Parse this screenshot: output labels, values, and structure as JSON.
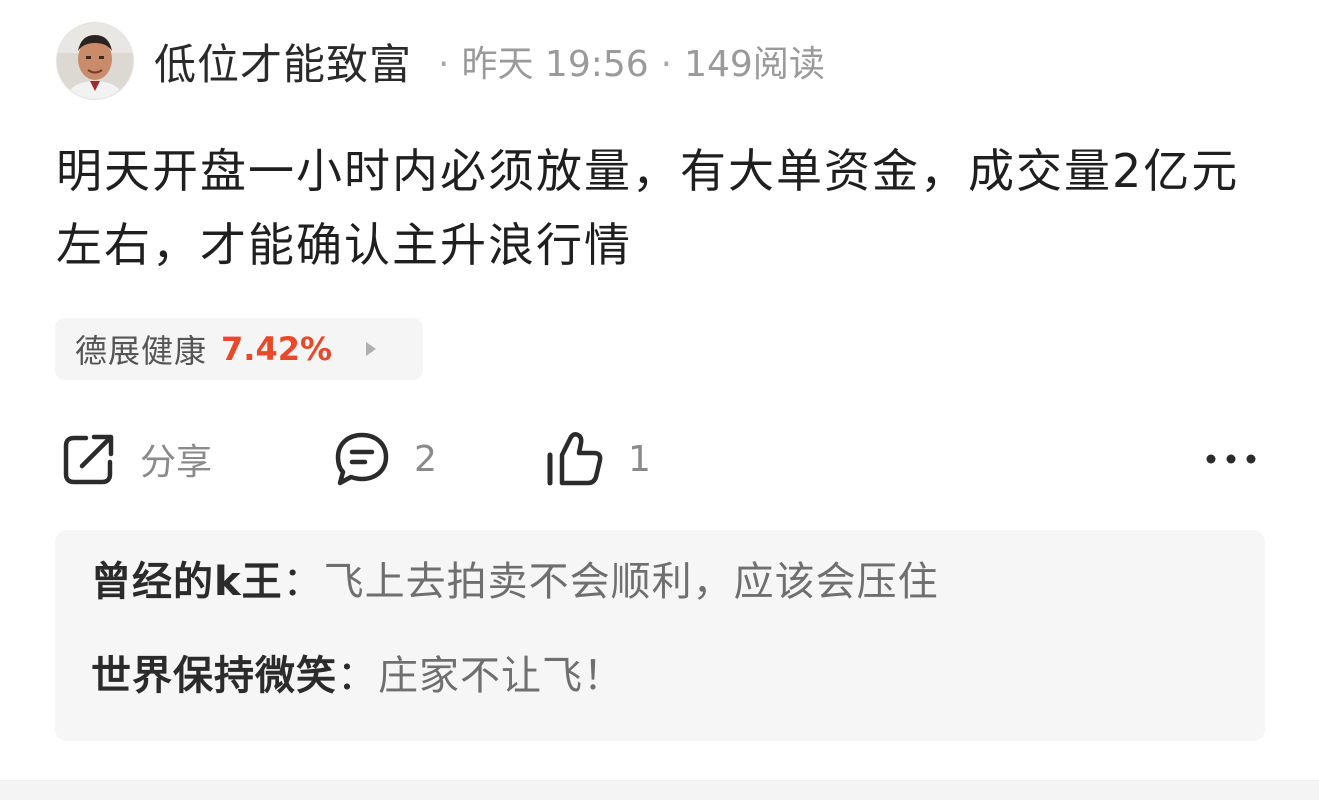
{
  "post": {
    "author": "低位才能致富",
    "time": "昨天 19:56",
    "reads": "149阅读",
    "separator": "·",
    "content": "明天开盘一小时内必须放量，有大单资金，成交量2亿元左右，才能确认主升浪行情"
  },
  "stock_tag": {
    "name": "德展健康",
    "change": "7.42%",
    "change_color": "#e8492b"
  },
  "actions": {
    "share_label": "分享",
    "comment_count": "2",
    "like_count": "1",
    "more_icon": "more-icon"
  },
  "comments": [
    {
      "user": "曾经的k王",
      "separator": "：",
      "text": "飞上去拍卖不会顺利，应该会压住"
    },
    {
      "user": "世界保持微笑",
      "separator": "：",
      "text": "庄家不让飞！"
    }
  ]
}
